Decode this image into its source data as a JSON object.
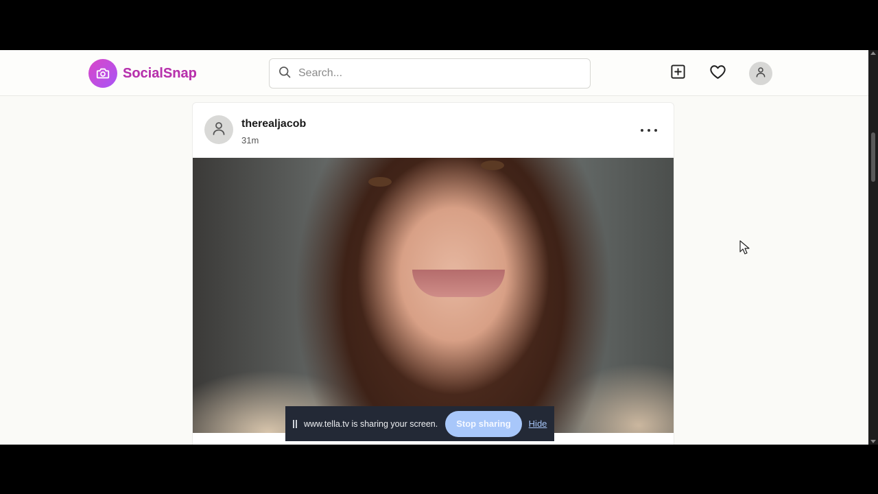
{
  "header": {
    "brand": "SocialSnap",
    "search_placeholder": "Search..."
  },
  "post": {
    "username": "therealjacob",
    "time_ago": "31m"
  },
  "screen_share": {
    "message": "www.tella.tv is sharing your screen.",
    "stop_label": "Stop sharing",
    "hide_label": "Hide"
  },
  "colors": {
    "brand_gradient_start": "#d946c7",
    "brand_gradient_end": "#a855f7",
    "share_bar_bg": "#232936",
    "stop_button_bg": "#a8c7fa"
  },
  "icons": {
    "logo": "camera-icon",
    "search": "search-icon",
    "create": "plus-square-icon",
    "likes": "heart-icon",
    "profile": "user-icon",
    "post_menu": "more-horizontal-icon"
  }
}
